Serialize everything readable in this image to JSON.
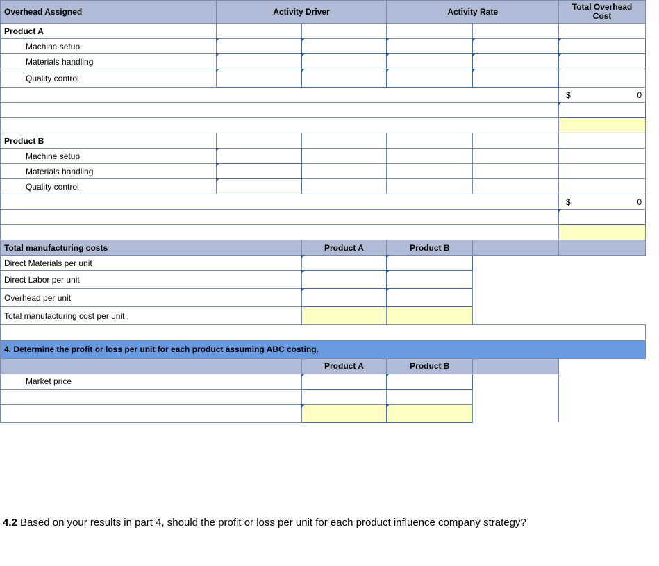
{
  "headers": {
    "overhead_assigned": "Overhead Assigned",
    "activity_driver": "Activity Driver",
    "activity_rate": "Activity Rate",
    "total_overhead_cost": "Total Overhead Cost",
    "product_a": "Product A",
    "product_b": "Product B"
  },
  "rows": {
    "product_a": "Product A",
    "product_b": "Product B",
    "machine_setup": "Machine setup",
    "materials_handling": "Materials handling",
    "quality_control": "Quality control",
    "total_mfg_costs": "Total manufacturing costs",
    "direct_materials": "Direct Materials per unit",
    "direct_labor": "Direct Labor per unit",
    "overhead_per_unit": "Overhead per unit",
    "total_mfg_per_unit": "Total manufacturing cost per unit",
    "market_price": "Market price"
  },
  "totals": {
    "a_symbol": "$",
    "a_value": "0",
    "b_symbol": "$",
    "b_value": "0"
  },
  "section4": "4. Determine the profit or loss per unit for each product assuming ABC costing.",
  "question42_num": "4.2",
  "question42_text": " Based on your results in part 4, should the profit or loss per unit for each product influence company strategy?"
}
